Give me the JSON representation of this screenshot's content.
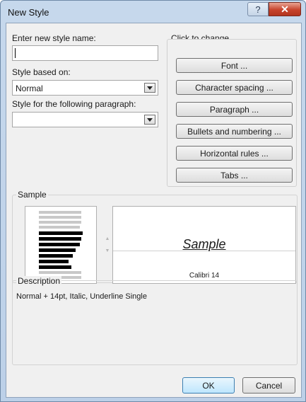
{
  "window": {
    "title": "New Style",
    "help_glyph": "?",
    "close_glyph": "✕"
  },
  "form": {
    "name_label": "Enter new style name:",
    "name_value": "",
    "based_on_label": "Style based on:",
    "based_on_value": "Normal",
    "following_label": "Style for the following paragraph:",
    "following_value": ""
  },
  "change_panel": {
    "title": "Click to change",
    "buttons": [
      "Font ...",
      "Character spacing ...",
      "Paragraph ...",
      "Bullets and numbering ...",
      "Horizontal rules ...",
      "Tabs ..."
    ]
  },
  "sample": {
    "group_label": "Sample",
    "preview_text": "Sample",
    "font_caption": "Calibri 14"
  },
  "description": {
    "group_label": "Description",
    "text": "Normal +  14pt, Italic,  Underline Single"
  },
  "footer": {
    "ok_label": "OK",
    "cancel_label": "Cancel"
  },
  "icons": [
    "help-icon",
    "close-icon",
    "chevron-down-icon",
    "spin-up-icon",
    "spin-down-icon"
  ]
}
